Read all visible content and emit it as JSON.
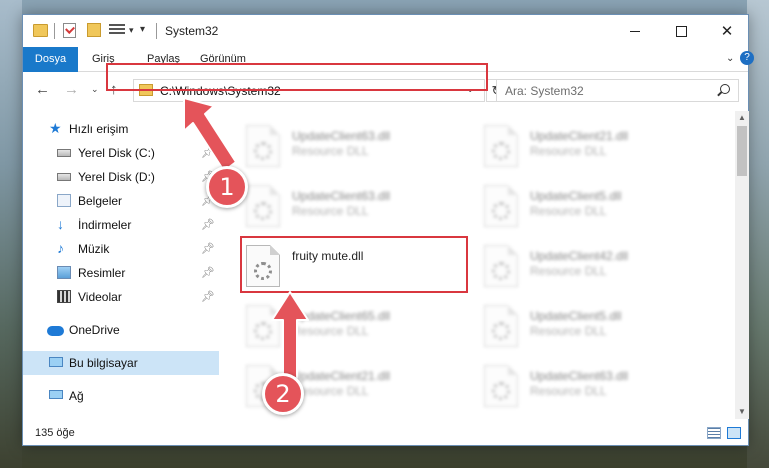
{
  "window": {
    "title": "System32",
    "minimize_label": "–",
    "maximize_label": "☐",
    "close_label": "✕"
  },
  "ribbon": {
    "tabs": [
      "Dosya",
      "Giriş",
      "Paylaş",
      "Görünüm"
    ],
    "help_label": "?"
  },
  "navigation": {
    "address": "C:\\Windows\\System32",
    "search_placeholder": "Ara: System32"
  },
  "sidebar": {
    "items": [
      {
        "label": "Hızlı erişim",
        "icon": "star-icon"
      },
      {
        "label": "Yerel Disk (C:)",
        "icon": "drive-icon",
        "pinned": true
      },
      {
        "label": "Yerel Disk (D:)",
        "icon": "drive-icon",
        "pinned": true
      },
      {
        "label": "Belgeler",
        "icon": "documents-icon",
        "pinned": true
      },
      {
        "label": "İndirmeler",
        "icon": "downloads-icon",
        "pinned": true
      },
      {
        "label": "Müzik",
        "icon": "music-icon",
        "pinned": true
      },
      {
        "label": "Resimler",
        "icon": "pictures-icon",
        "pinned": true
      },
      {
        "label": "Videolar",
        "icon": "videos-icon",
        "pinned": true
      },
      {
        "label": "OneDrive",
        "icon": "cloud-icon"
      },
      {
        "label": "Bu bilgisayar",
        "icon": "computer-icon",
        "selected": true
      },
      {
        "label": "Ağ",
        "icon": "network-icon"
      }
    ]
  },
  "files": [
    {
      "name": "UpdateClient63.dll",
      "type": "Resource DLL"
    },
    {
      "name": "UpdateClient21.dll",
      "type": "Resource DLL"
    },
    {
      "name": "UpdateClient63.dll",
      "type": "Resource DLL"
    },
    {
      "name": "UpdateClient5.dll",
      "type": "Resource DLL"
    },
    {
      "name": "fruity mute.dll",
      "type": ""
    },
    {
      "name": "UpdateClient42.dll",
      "type": "Resource DLL"
    },
    {
      "name": "UpdateClient65.dll",
      "type": "Resource DLL"
    },
    {
      "name": "UpdateClient5.dll",
      "type": "Resource DLL"
    },
    {
      "name": "UpdateClient21.dll",
      "type": "Resource DLL"
    },
    {
      "name": "UpdateClient63.dll",
      "type": "Resource DLL"
    }
  ],
  "status": {
    "item_count": "135 öğe"
  },
  "annotations": {
    "step1": "1",
    "step2": "2",
    "color": "#e4545a"
  }
}
